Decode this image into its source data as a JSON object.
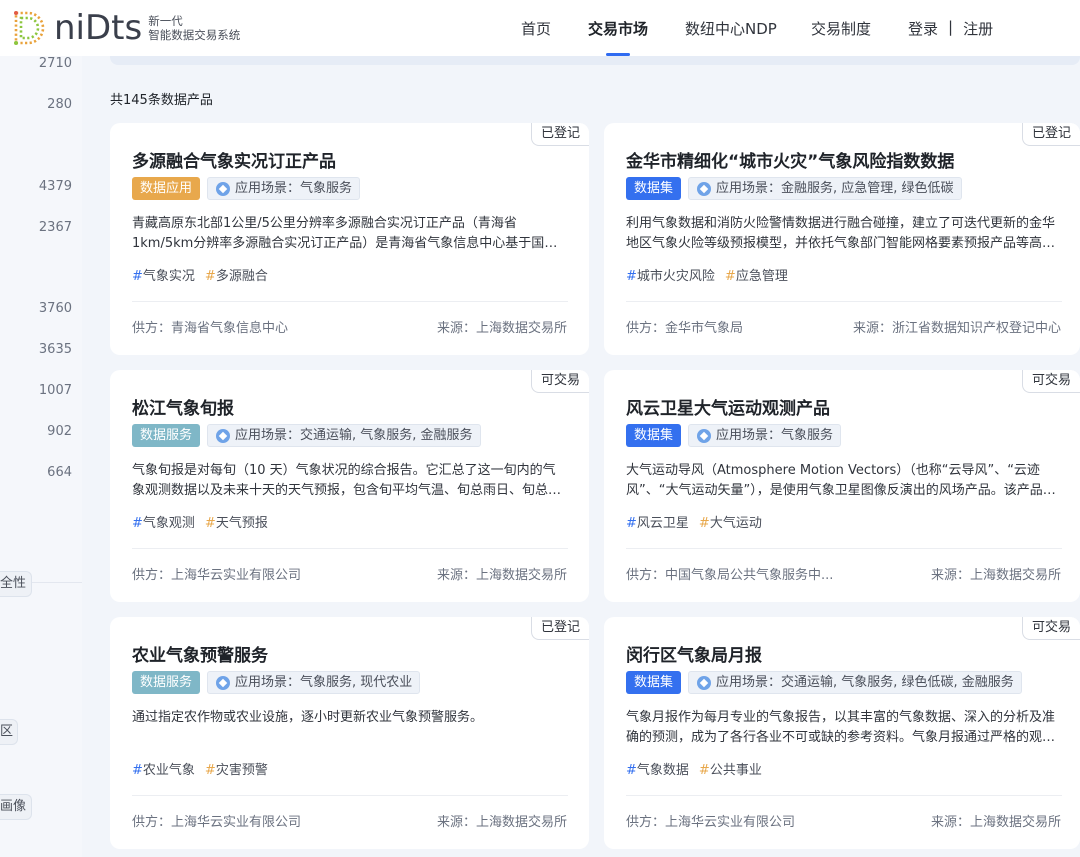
{
  "brand": {
    "word": "niDts",
    "line1": "新一代",
    "line2": "智能数据交易系统"
  },
  "nav": {
    "items": [
      {
        "label": "首页"
      },
      {
        "label": "交易市场"
      },
      {
        "label": "数纽中心NDP"
      },
      {
        "label": "交易制度"
      }
    ],
    "active": "交易市场",
    "login": "登录",
    "separator": "|",
    "register": "注册"
  },
  "sidebar": {
    "counts": [
      "2710",
      "280",
      "4379",
      "2367",
      "3760",
      "3635",
      "1007",
      "902",
      "664"
    ],
    "tags": [
      "全性",
      "区",
      "画像"
    ]
  },
  "list": {
    "total_label": "共145条数据产品"
  },
  "cards": [
    {
      "status": "已登记",
      "title": "多源融合气象实况订正产品",
      "type": "数据应用",
      "type_style": "app",
      "scene": "应用场景：气象服务",
      "desc": "青藏高原东北部1公里/5公里分辨率多源融合实况订正产品（青海省1km/5km分辨率多源融合实况订正产品）是青海省气象信息中心基于国家…",
      "kw1": "气象实况",
      "kw2": "多源融合",
      "supplier": "供方：青海省气象信息中心",
      "source": "来源：上海数据交易所"
    },
    {
      "status": "已登记",
      "title": "金华市精细化“城市火灾”气象风险指数数据",
      "type": "数据集",
      "type_style": "set",
      "scene": "应用场景：金融服务, 应急管理, 绿色低碳",
      "desc": "利用气象数据和消防火险警情数据进行融合碰撞，建立了可迭代更新的金华地区气象火险等级预报模型，并依托气象部门智能网格要素预报产品等高…",
      "kw1": "城市火灾风险",
      "kw2": "应急管理",
      "supplier": "供方：金华市气象局",
      "source": "来源：浙江省数据知识产权登记中心"
    },
    {
      "status": "可交易",
      "title": "松江气象旬报",
      "type": "数据服务",
      "type_style": "svc",
      "scene": "应用场景：交通运输, 气象服务, 金融服务",
      "desc": "气象旬报是对每旬（10 天）气象状况的综合报告。它汇总了这一旬内的气象观测数据以及未来十天的天气预报，包含旬平均气温、旬总雨日、旬总雨…",
      "kw1": "气象观测",
      "kw2": "天气预报",
      "supplier": "供方：上海华云实业有限公司",
      "source": "来源：上海数据交易所"
    },
    {
      "status": "可交易",
      "title": "风云卫星大气运动观测产品",
      "type": "数据集",
      "type_style": "set",
      "scene": "应用场景：气象服务",
      "desc": "大气运动导风（Atmosphere Motion Vectors）（也称“云导风”、“云迹风”、“大气运动矢量”），是使用气象卫星图像反演出的风场产品。该产品…",
      "kw1": "风云卫星",
      "kw2": "大气运动",
      "supplier": "供方：中国气象局公共气象服务中...",
      "source": "来源：上海数据交易所"
    },
    {
      "status": "已登记",
      "title": "农业气象预警服务",
      "type": "数据服务",
      "type_style": "svc",
      "scene": "应用场景：气象服务, 现代农业",
      "desc": "通过指定农作物或农业设施，逐小时更新农业气象预警服务。",
      "kw1": "农业气象",
      "kw2": "灾害预警",
      "supplier": "供方：上海华云实业有限公司",
      "source": "来源：上海数据交易所"
    },
    {
      "status": "可交易",
      "title": "闵行区气象局月报",
      "type": "数据集",
      "type_style": "set",
      "scene": "应用场景：交通运输, 气象服务, 绿色低碳, 金融服务",
      "desc": "气象月报作为每月专业的气象报告，以其丰富的气象数据、深入的分析及准确的预测，成为了各行各业不可或缺的参考资料。气象月报通过严格的观…",
      "kw1": "气象数据",
      "kw2": "公共事业",
      "supplier": "供方：上海华云实业有限公司",
      "source": "来源：上海数据交易所"
    }
  ]
}
